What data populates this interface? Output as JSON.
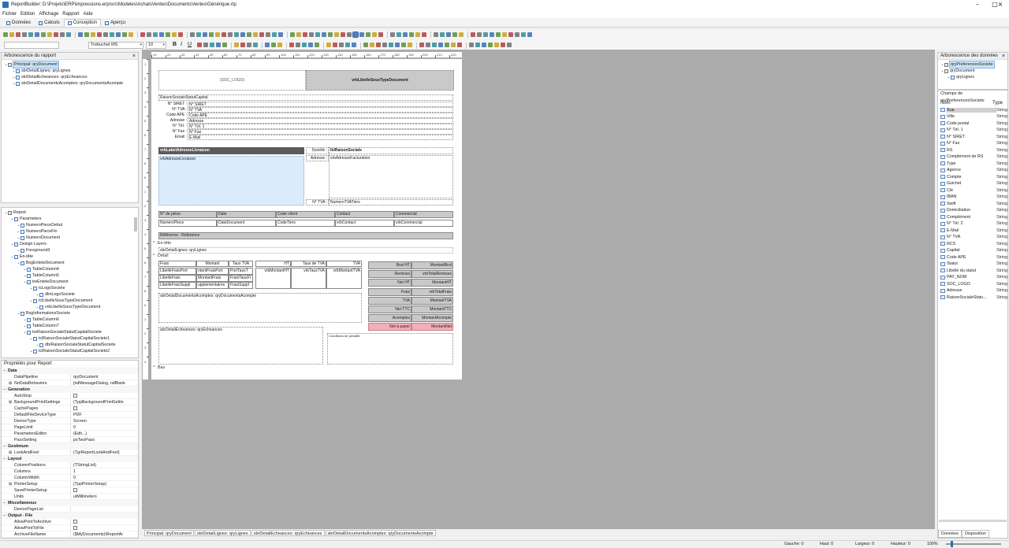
{
  "window": {
    "title": "ReportBuilder: D:\\Projets\\ERP\\impressions-erp\\src\\Modeles\\AchatsVentes\\DocumentsVentes\\Générique.rtp"
  },
  "menu": [
    "Fichier",
    "Edition",
    "Affichage",
    "Rapport",
    "Aide"
  ],
  "tabs": [
    {
      "label": "Données",
      "active": false
    },
    {
      "label": "Calculs",
      "active": false
    },
    {
      "label": "Conception",
      "active": true
    },
    {
      "label": "Aperçu",
      "active": false
    }
  ],
  "format": {
    "font_name": "Trebuchet MS",
    "font_size": "10"
  },
  "colors": {
    "accent": "#2a6ebb",
    "pink": "#f4aeb6",
    "canvas": "#ababab"
  },
  "report_tree": {
    "title": "Arborescence du rapport",
    "items": [
      {
        "label": "Principal: qryDocument",
        "level": 0,
        "selected": true
      },
      {
        "label": "sbrDetailLignes: qryLignes",
        "level": 1
      },
      {
        "label": "sbrDetailEcheances: qryEcheances",
        "level": 1
      },
      {
        "label": "sbrDetailDocumentsAcomptes: qryDocumentsAcompte",
        "level": 1
      }
    ]
  },
  "object_tree": {
    "items": [
      {
        "label": "Report",
        "level": 0
      },
      {
        "label": "Parameters",
        "level": 1
      },
      {
        "label": "NumeroPieceDebut",
        "level": 2
      },
      {
        "label": "NumeroPieceFin",
        "level": 2
      },
      {
        "label": "NumeroDocument",
        "level": 2
      },
      {
        "label": "Design Layers",
        "level": 1
      },
      {
        "label": "Foreground3",
        "level": 2
      },
      {
        "label": "En-tête",
        "level": 1
      },
      {
        "label": "BxgEnteteDocument",
        "level": 2
      },
      {
        "label": "TableColumn4",
        "level": 3
      },
      {
        "label": "TableColumn5",
        "level": 3
      },
      {
        "label": "treEnteteDocument",
        "level": 3
      },
      {
        "label": "tcLogoSociete",
        "level": 4
      },
      {
        "label": "dlmLogoSociete",
        "level": 5
      },
      {
        "label": "tclLibelleSousTypeDocument",
        "level": 4
      },
      {
        "label": "vrbLibelleSousTypeDocument",
        "level": 5
      },
      {
        "label": "BxgInformationsSociete",
        "level": 2
      },
      {
        "label": "TableColumn6",
        "level": 3
      },
      {
        "label": "TableColumn7",
        "level": 3
      },
      {
        "label": "treRaisonSocialeStatutCapitalSociete",
        "level": 3
      },
      {
        "label": "tclRaisonSocialeStatutCapitalSociete1",
        "level": 4
      },
      {
        "label": "dbrRaisonSocialeStatutCapitalSociete",
        "level": 5
      },
      {
        "label": "tclRaisonSocialeStatutCapitalSociete2",
        "level": 4
      }
    ]
  },
  "properties": {
    "title": "Propriétés pour Report",
    "groups": [
      {
        "name": "Data",
        "rows": [
          {
            "name": "DataPipeline",
            "value": "qryDocument"
          },
          {
            "name": "NoDataBehaviors",
            "value": "[ndMessageDialog, ndBlank",
            "expand": true
          }
        ]
      },
      {
        "name": "Generation",
        "rows": [
          {
            "name": "AutoStop",
            "value": "",
            "check": true
          },
          {
            "name": "BackgroundPrintSettings",
            "value": "(TppBackgroundPrintSettin",
            "expand": true
          },
          {
            "name": "CachePages",
            "value": "",
            "check": true
          },
          {
            "name": "DefaultFileDeviceType",
            "value": "PDF"
          },
          {
            "name": "DeviceType",
            "value": "Screen"
          },
          {
            "name": "PageLimit",
            "value": "0"
          },
          {
            "name": "ParametersEditor",
            "value": "(Edit...)"
          },
          {
            "name": "PassSetting",
            "value": "psTwoPass"
          }
        ]
      },
      {
        "name": "Gestimum",
        "rows": [
          {
            "name": "LookAndFeel",
            "value": "(TgrReportLookAndFeel)",
            "expand": true
          }
        ]
      },
      {
        "name": "Layout",
        "rows": [
          {
            "name": "ColumnPositions",
            "value": "(TStringList)"
          },
          {
            "name": "Columns",
            "value": "1"
          },
          {
            "name": "ColumnWidth",
            "value": "0"
          },
          {
            "name": "PrinterSetup",
            "value": "(TppPrinterSetup)",
            "expand": true
          },
          {
            "name": "SavePrinterSetup",
            "value": "",
            "check": true
          },
          {
            "name": "Units",
            "value": "utMillimeters"
          }
        ]
      },
      {
        "name": "Miscellaneous",
        "rows": [
          {
            "name": "DevicePageList",
            "value": ""
          }
        ]
      },
      {
        "name": "Output - File",
        "rows": [
          {
            "name": "AllowPrintToArchive",
            "value": "",
            "check": true
          },
          {
            "name": "AllowPrintToFile",
            "value": "",
            "check": true
          },
          {
            "name": "ArchiveFileName",
            "value": "($MyDocuments)\\ReportAr"
          }
        ]
      }
    ]
  },
  "report": {
    "logo": "(SOC_LOGO)",
    "doc_type": "vrbLibelleSousTypeDocument",
    "raison_sociale": "RaisonSocialeStatutCapital",
    "soc_lines": [
      {
        "label": "N° SIRET :",
        "value": "N° SIRET"
      },
      {
        "label": "N° TVA :",
        "value": "N° TVA"
      },
      {
        "label": "Code APE :",
        "value": "Code APE"
      },
      {
        "label": "Adresse :",
        "value": "Adresse"
      },
      {
        "label": "N° Tél. :",
        "value": "N° Tél. 1"
      },
      {
        "label": "N° Fax :",
        "value": "N° Fax"
      },
      {
        "label": "Email :",
        "value": "E-Mail"
      }
    ],
    "livraison_label": "vrbLabelAdresseLivraison",
    "livraison_adresse": "vrbAdresseLivraison",
    "societe_label": "Société :",
    "societe_value": "lblRaisonSociale",
    "adresse_label": "Adresse :",
    "adresse_value": "vrbAdresseFacturation",
    "tva_label": "N° TVA :",
    "tva_value": "NumeroTVATiers",
    "info_headers": [
      "N° de pièce",
      "Date",
      "Code client",
      "Contact",
      "Commercial"
    ],
    "info_values": [
      "NumeroPiece",
      "DateDocument",
      "CodeTiers",
      "vrbContact",
      "vrbCommercial"
    ],
    "reference": "Référence : Reference",
    "band_entete": "En-tête",
    "sub_lignes": "sbrDetailLignes: qryLignes",
    "band_detail": "Détail",
    "frais_headers": [
      "Frais",
      "Montant",
      "Taux TVA"
    ],
    "frais_rows": [
      [
        "LibelleFraisPort",
        "ntantFraisPort",
        "PortTauxT"
      ],
      [
        "LibelleFrais",
        "MontantFrais",
        "FraisTauxFr"
      ],
      [
        "LibelleFraisSuppl",
        "upplementaires",
        "FraisSuppl"
      ]
    ],
    "tva_headers": [
      "HT",
      "Taux de TVA",
      "TVA"
    ],
    "tva_values": [
      "vrbMontantHT",
      "vrbTauxTVA",
      "vrbMontantTVA"
    ],
    "totals": [
      {
        "label": "Brut HT",
        "value": "MontantBrut"
      },
      {
        "label": "Remises",
        "value": "vrbTotalRemises"
      },
      {
        "label": "Net HT",
        "value": "MontantHT"
      },
      {
        "label": "Frais",
        "value": "vrbTotalFrais"
      },
      {
        "label": "TVA",
        "value": "MontantTVA"
      },
      {
        "label": "Net TTC",
        "value": "MontantTTC"
      },
      {
        "label": "Acomptes",
        "value": "MontantAcompte"
      },
      {
        "label": "Net à payer",
        "value": "MontantNet"
      }
    ],
    "sub_acomptes": "sbrDetailDocumentsAcomptes: qryDocumentsAcompte",
    "sub_echeances": "sbrDetailEcheances: qryEcheances",
    "conditions": "Conditions de pénalité",
    "band_bas": "Bas"
  },
  "data_tree": {
    "title": "Arborescence des données",
    "items": [
      {
        "label": "qryPreferencesSociete",
        "level": 0,
        "selected": true
      },
      {
        "label": "qryDocument",
        "level": 0
      },
      {
        "label": "qryLignes",
        "level": 1
      }
    ]
  },
  "fields": {
    "title": "Champs de qryPreferencesSociete",
    "col_name": "Nom",
    "col_type": "Type",
    "items": [
      {
        "name": "Rue",
        "type": "String",
        "selected": true
      },
      {
        "name": "Ville",
        "type": "String"
      },
      {
        "name": "Code postal",
        "type": "String"
      },
      {
        "name": "N° Tél. 1",
        "type": "String"
      },
      {
        "name": "N° SIRET",
        "type": "String"
      },
      {
        "name": "N° Fax",
        "type": "String"
      },
      {
        "name": "RS",
        "type": "String"
      },
      {
        "name": "Complément de RS",
        "type": "String"
      },
      {
        "name": "Type",
        "type": "String"
      },
      {
        "name": "Agence",
        "type": "String"
      },
      {
        "name": "Compte",
        "type": "String"
      },
      {
        "name": "Guichet",
        "type": "String"
      },
      {
        "name": "Clé",
        "type": "String"
      },
      {
        "name": "IBAN",
        "type": "String"
      },
      {
        "name": "Swift",
        "type": "String"
      },
      {
        "name": "Domiciliation",
        "type": "String"
      },
      {
        "name": "Complément",
        "type": "String"
      },
      {
        "name": "N° Tél. 2",
        "type": "String"
      },
      {
        "name": "E-Mail",
        "type": "String"
      },
      {
        "name": "N° TVA",
        "type": "String"
      },
      {
        "name": "RCS",
        "type": "String"
      },
      {
        "name": "Capital",
        "type": "String"
      },
      {
        "name": "Code APE",
        "type": "String"
      },
      {
        "name": "Statut",
        "type": "String"
      },
      {
        "name": "Libellé du statut",
        "type": "String"
      },
      {
        "name": "PAY_NOM",
        "type": "String"
      },
      {
        "name": "SOC_LOGO",
        "type": "String"
      },
      {
        "name": "Adresse",
        "type": "String"
      },
      {
        "name": "RaisonSocialeStatu...",
        "type": "String"
      }
    ],
    "tabs": [
      "Données",
      "Disposition"
    ]
  },
  "bottom_tabs": [
    "Principal: qryDocument",
    "sbrDetailLignes: qryLignes",
    "sbrDetailEcheances: qryEcheances",
    "sbrDetailDocumentsAcomptes: qryDocumentsAcompte"
  ],
  "ruler_h": [
    "10",
    "20",
    "30",
    "40",
    "50",
    "60",
    "70",
    "80",
    "90",
    "100",
    "110",
    "120",
    "130",
    "140",
    "150",
    "160",
    "170",
    "180",
    "190",
    "200",
    "210",
    "220"
  ],
  "ruler_v": [
    "1",
    "2",
    "3",
    "4",
    "5",
    "6",
    "7",
    "8",
    "9",
    "1",
    "2",
    "3",
    "4",
    "5",
    "6",
    "7",
    "8",
    "9",
    "1",
    "2",
    "3",
    "4"
  ],
  "status": {
    "gauche": "Gauche: 0",
    "haut": "Haut: 0",
    "largeur": "Largeur: 0",
    "hauteur": "Hauteur: 0",
    "zoom": "100%"
  }
}
